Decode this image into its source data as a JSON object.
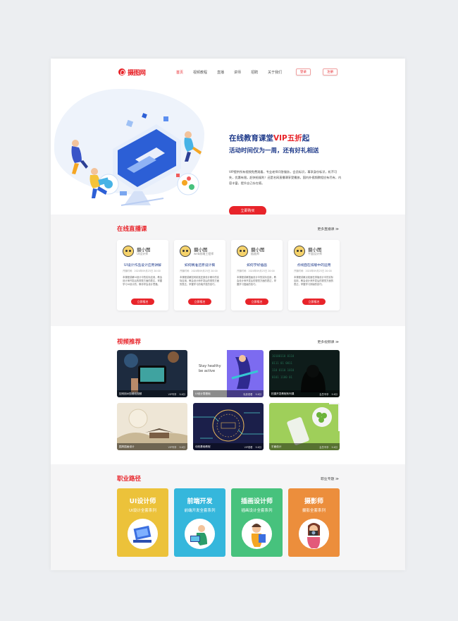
{
  "header": {
    "logo_text": "摄图网",
    "nav": [
      "首页",
      "视频教程",
      "直播",
      "讲师",
      "招聘",
      "关于我们"
    ],
    "login": "登录",
    "register": "注册"
  },
  "hero": {
    "title_prefix": "在线教育课堂",
    "title_vip": "VIP五折",
    "title_suffix": "起",
    "subtitle": "活动时间仅为一周，还有好礼相送",
    "description": "VIP提供所有视频免费观看，专业老师问答服务，会员标识，尊享身份标识，机不可失，优惠有限，赶快抢福利！还是名网直播课享受播放，国内外视频教程应有尽有，内容丰富，提升自己存在感。",
    "button": "立即购买"
  },
  "live": {
    "title": "在线直播课",
    "more": "更多直播课 ≫",
    "cards": [
      {
        "name": "摄小图",
        "role": "UI设计师",
        "title": "UI设计作品设计应用讲解",
        "time": "开播时间：2020年09月25日 20:00",
        "text": "本课程讲解UI设计中的实际应用，教会设计师开发后的视觉方面的表达，掌握学习UI设计的，教你学会设计思路。",
        "button": "立即报名"
      },
      {
        "name": "摄小图",
        "role": "web前端工程师",
        "title": "如何精准还原设计稿",
        "time": "开播时间：2020年09月25日 20:00",
        "text": "本课程讲解如何精准还原设计稿中的实际应用，教会设计师开发后的视觉方面的表达，掌握学习前端开发的技巧。",
        "button": "立即报名"
      },
      {
        "name": "摄小图",
        "role": "插画师",
        "title": "如何学好插画",
        "time": "开播时间：2020年09月25日 20:00",
        "text": "本课程讲解插画设计中的实际应用，教会设计师开发后的视觉方面的表达，掌握学习插画的技巧。",
        "button": "立即报名"
      },
      {
        "name": "摄小图",
        "role": "平面设计师",
        "title": "点线面在排版中的运用",
        "time": "开播时间：2020年09月25日 20:00",
        "text": "本课程讲解点线面在排版设计中的实际应用，教会设计师开发后的视觉方面的表达，掌握学习排版的技巧。",
        "button": "立即报名"
      }
    ]
  },
  "video": {
    "title": "视频推荐",
    "more": "更多视频课 ≫",
    "cards": [
      {
        "title": "如何用AI剪辑短视频",
        "tag": "VIP专享",
        "score": "9.6分"
      },
      {
        "title": "UI设计零基础",
        "tag": "免费观看",
        "score": "9.6分"
      },
      {
        "title": "拍摄开发教程系列课",
        "tag": "会员专享",
        "score": "9.6分"
      },
      {
        "title": "国风插画设计",
        "tag": "VIP专享",
        "score": "9.6分"
      },
      {
        "title": "动效基础教程",
        "tag": "VIP观看",
        "score": "9.6分"
      },
      {
        "title": "平面设计",
        "tag": "会员专享",
        "score": "9.6分"
      }
    ]
  },
  "career": {
    "title": "职业路径",
    "more": "职业专题 ≫",
    "cards": [
      {
        "title": "UI设计师",
        "sub": "UI设计全套系列",
        "color": "#ecc23a"
      },
      {
        "title": "前端开发",
        "sub": "前端开发全套系列",
        "color": "#35b7dc"
      },
      {
        "title": "插画设计师",
        "sub": "插画设计全套系列",
        "color": "#47c27d"
      },
      {
        "title": "摄影师",
        "sub": "摄影全套系列",
        "color": "#ec8e3c"
      }
    ]
  },
  "colors": {
    "accent": "#e8242a",
    "navy": "#1e3a8a"
  }
}
